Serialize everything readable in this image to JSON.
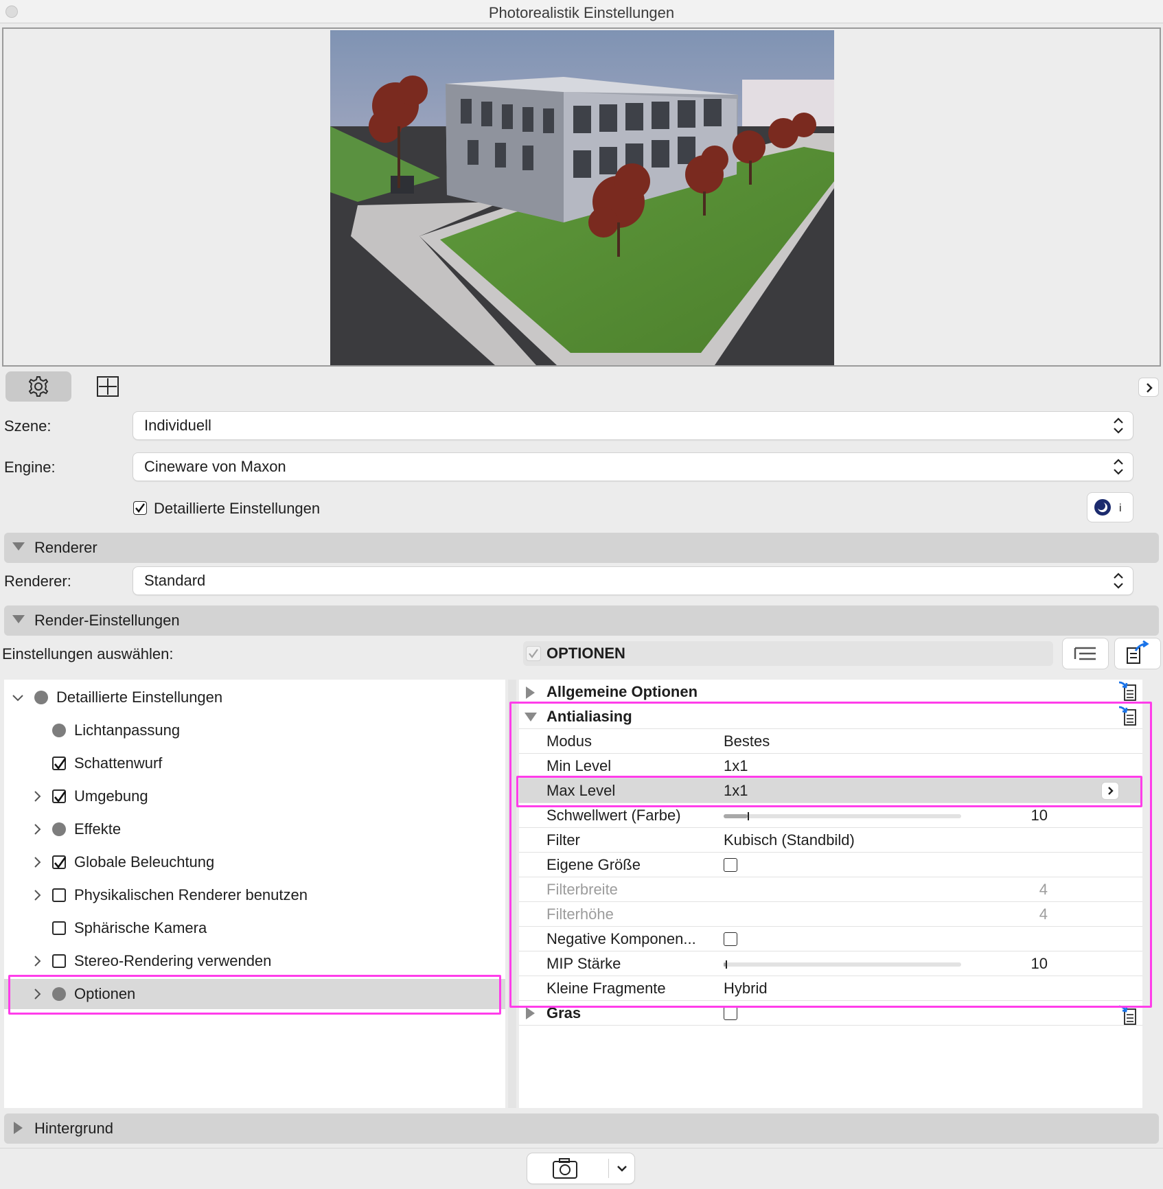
{
  "window": {
    "title": "Photorealistik Einstellungen"
  },
  "icons": {
    "close_dot": "close-dot-icon",
    "gear": "gear-icon",
    "fit": "fit-frame-icon",
    "expand": "chevron-right-icon",
    "updown": "updown-arrows-icon",
    "cineware_info": "cineware-info-icon",
    "list_view": "list-view-icon",
    "export": "export-icon",
    "camera": "camera-icon",
    "chevron_down": "chevron-down-icon",
    "doc_preset": "document-preset-icon"
  },
  "scene": {
    "label": "Szene:",
    "value": "Individuell"
  },
  "engine": {
    "label": "Engine:",
    "value": "Cineware von Maxon"
  },
  "detailed_checkbox": {
    "label": "Detaillierte Einstellungen",
    "checked": true
  },
  "renderer_section": {
    "title": "Renderer"
  },
  "renderer": {
    "label": "Renderer:",
    "value": "Standard"
  },
  "render_settings_section": {
    "title": "Render-Einstellungen"
  },
  "select_settings_label": "Einstellungen auswählen:",
  "options_header": {
    "title": "OPTIONEN"
  },
  "tree": [
    {
      "label": "Detaillierte Einstellungen",
      "mark": "circle",
      "expandable": true,
      "expanded": true,
      "indent": 0
    },
    {
      "label": "Lichtanpassung",
      "mark": "circle",
      "expandable": false,
      "indent": 1
    },
    {
      "label": "Schattenwurf",
      "mark": "checked",
      "expandable": false,
      "indent": 1
    },
    {
      "label": "Umgebung",
      "mark": "checked",
      "expandable": true,
      "indent": 1
    },
    {
      "label": "Effekte",
      "mark": "circle",
      "expandable": true,
      "indent": 1
    },
    {
      "label": "Globale Beleuchtung",
      "mark": "checked",
      "expandable": true,
      "indent": 1
    },
    {
      "label": "Physikalischen Renderer benutzen",
      "mark": "unchecked",
      "expandable": true,
      "indent": 1
    },
    {
      "label": "Sphärische Kamera",
      "mark": "unchecked",
      "expandable": false,
      "indent": 1
    },
    {
      "label": "Stereo-Rendering verwenden",
      "mark": "unchecked",
      "expandable": true,
      "indent": 1
    },
    {
      "label": "Optionen",
      "mark": "circle",
      "expandable": true,
      "indent": 1,
      "selected": true
    }
  ],
  "properties": {
    "group_general": "Allgemeine Optionen",
    "group_antialiasing": "Antialiasing",
    "rows": [
      {
        "key": "Modus",
        "value": "Bestes"
      },
      {
        "key": "Min Level",
        "value": "1x1"
      },
      {
        "key": "Max Level",
        "value": "1x1",
        "selected": true
      },
      {
        "key": "Schwellwert (Farbe)",
        "slider_value": "10",
        "slider_fraction": 0.1
      },
      {
        "key": "Filter",
        "value": "Kubisch (Standbild)"
      },
      {
        "key": "Eigene Größe",
        "checkbox": false
      },
      {
        "key": "Filterbreite",
        "number": "4",
        "disabled": true
      },
      {
        "key": "Filterhöhe",
        "number": "4",
        "disabled": true
      },
      {
        "key": "Negative Komponen...",
        "checkbox": false
      },
      {
        "key": "MIP Stärke",
        "slider_value": "10",
        "slider_fraction": 0.01
      },
      {
        "key": "Kleine Fragmente",
        "value": "Hybrid"
      }
    ],
    "group_gras": "Gras"
  },
  "background_section": {
    "title": "Hintergrund"
  },
  "colors": {
    "highlight": "#ff3dea",
    "section_bg": "#d3d3d3",
    "selected_row": "#d9d9d9"
  }
}
